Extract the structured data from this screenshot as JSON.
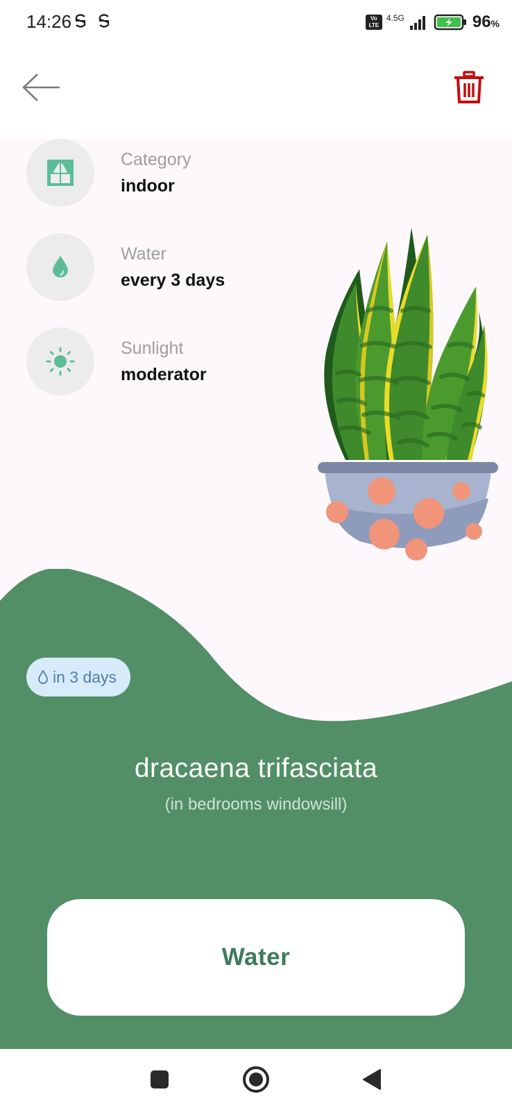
{
  "status_bar": {
    "time": "14:26",
    "network": "4.5G",
    "volte": "Vo LTE",
    "battery_percent": "96",
    "battery_unit": "%"
  },
  "app_bar": {
    "back_icon": "arrow-left-icon",
    "delete_icon": "trash-icon",
    "delete_color": "#c40d0d"
  },
  "info": {
    "category": {
      "label": "Category",
      "value": "indoor",
      "icon": "window-icon"
    },
    "water": {
      "label": "Water",
      "value": "every 3 days",
      "icon": "water-drop-icon"
    },
    "sunlight": {
      "label": "Sunlight",
      "value": "moderator",
      "icon": "sun-icon"
    }
  },
  "water_badge": {
    "icon": "water-drop-outline-icon",
    "text": "in 3 days"
  },
  "plant": {
    "name": "dracaena trifasciata",
    "location": "(in bedrooms windowsill)"
  },
  "water_button": {
    "label": "Water"
  },
  "colors": {
    "accent_green": "#528f66",
    "icon_teal": "#5bbd98",
    "badge_bg": "#d7ebfb",
    "content_bg": "#fcf8fc"
  },
  "nav_bar": {
    "recents_icon": "square-icon",
    "home_icon": "circle-icon",
    "back_icon": "triangle-back-icon"
  }
}
